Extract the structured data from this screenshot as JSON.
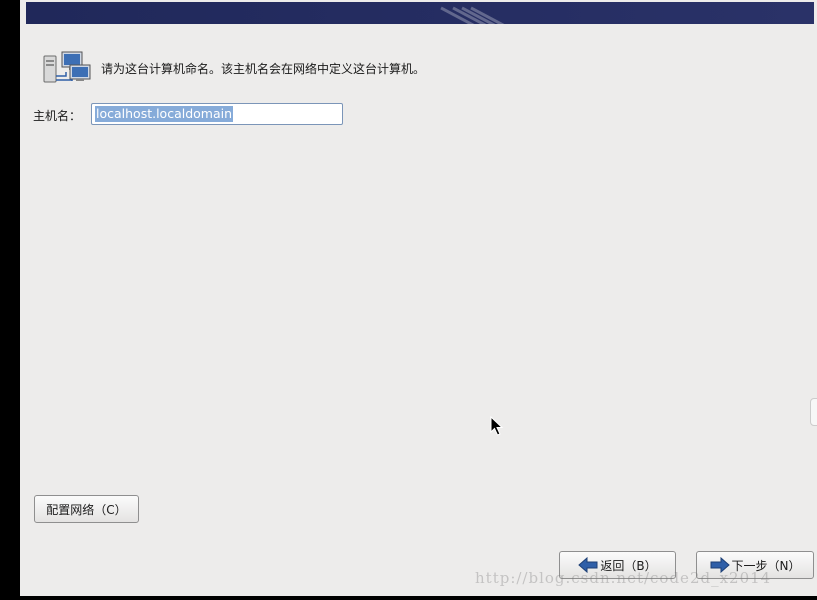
{
  "intro": {
    "text": "请为这台计算机命名。该主机名会在网络中定义这台计算机。",
    "icon": "network-computers-icon"
  },
  "hostname": {
    "label": "主机名：",
    "value": "localhost.localdomain"
  },
  "buttons": {
    "configure_network": "配置网络（C）",
    "back": "返回（B）",
    "next": "下一步（N）"
  },
  "watermark": "http://blog.csdn.net/code2d_x2014",
  "colors": {
    "banner": "#252d62",
    "panel": "#edeceb",
    "selection": "#86abd9",
    "arrow": "#2f5fa8"
  }
}
